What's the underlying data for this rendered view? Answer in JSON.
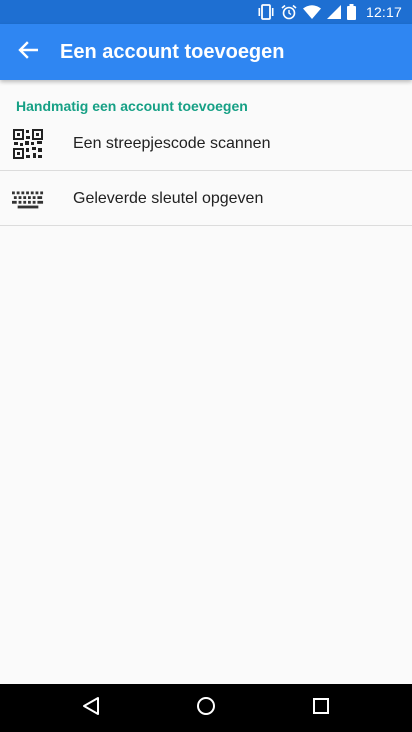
{
  "status_bar": {
    "time": "12:17",
    "icons": [
      "vibrate-icon",
      "alarm-icon",
      "wifi-icon",
      "signal-icon",
      "battery-icon"
    ]
  },
  "app_bar": {
    "title": "Een account toevoegen",
    "back_icon": "arrow-left-icon"
  },
  "section": {
    "header": "Handmatig een account toevoegen",
    "items": [
      {
        "label": "Een streepjescode scannen",
        "icon": "qr-code-icon"
      },
      {
        "label": "Geleverde sleutel opgeven",
        "icon": "keyboard-icon"
      }
    ]
  },
  "nav_bar": {
    "icons": [
      "back-triangle-icon",
      "home-circle-icon",
      "recents-square-icon"
    ]
  },
  "colors": {
    "status_bar": "#1e6fd2",
    "app_bar": "#2f86f2",
    "section_header": "#16a085",
    "background": "#fafafa"
  }
}
